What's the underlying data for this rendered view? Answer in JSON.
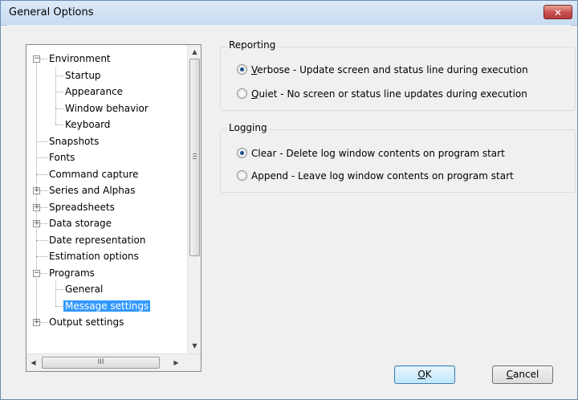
{
  "window": {
    "title": "General Options",
    "close_glyph": "✕"
  },
  "tree": {
    "items": [
      {
        "label": "Environment",
        "level": 0,
        "expander": "−"
      },
      {
        "label": "Startup",
        "level": 1
      },
      {
        "label": "Appearance",
        "level": 1
      },
      {
        "label": "Window behavior",
        "level": 1
      },
      {
        "label": "Keyboard",
        "level": 1
      },
      {
        "label": "Snapshots",
        "level": 0
      },
      {
        "label": "Fonts",
        "level": 0
      },
      {
        "label": "Command capture",
        "level": 0
      },
      {
        "label": "Series and Alphas",
        "level": 0,
        "expander": "+"
      },
      {
        "label": "Spreadsheets",
        "level": 0,
        "expander": "+"
      },
      {
        "label": "Data storage",
        "level": 0,
        "expander": "+"
      },
      {
        "label": "Date representation",
        "level": 0
      },
      {
        "label": "Estimation options",
        "level": 0
      },
      {
        "label": "Programs",
        "level": 0,
        "expander": "−"
      },
      {
        "label": "General",
        "level": 1
      },
      {
        "label": "Message settings",
        "level": 1,
        "selected": true
      },
      {
        "label": "Output settings",
        "level": 0,
        "expander": "+"
      }
    ],
    "scroll_grip": "III"
  },
  "reporting": {
    "title": "Reporting",
    "options": [
      {
        "mnemonic": "V",
        "rest": "erbose - Update screen and status line during execution",
        "checked": true
      },
      {
        "mnemonic": "Q",
        "rest": "uiet - No screen or status line updates during execution",
        "checked": false
      }
    ]
  },
  "logging": {
    "title": "Logging",
    "options": [
      {
        "mnemonic": "",
        "rest": "Clear - Delete log window contents on program start",
        "checked": true
      },
      {
        "mnemonic": "",
        "rest": "Append - Leave log window contents on program start",
        "checked": false
      }
    ]
  },
  "buttons": {
    "ok_mnemonic": "O",
    "ok_rest": "K",
    "cancel_mnemonic": "C",
    "cancel_rest": "ancel"
  }
}
